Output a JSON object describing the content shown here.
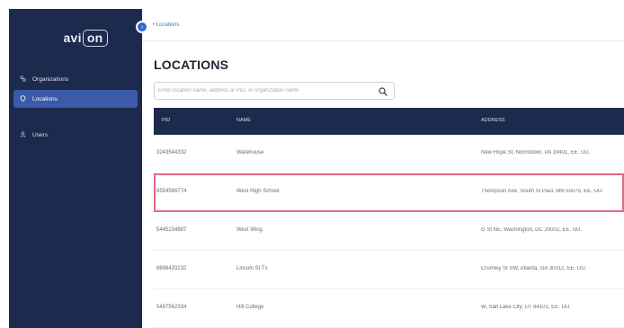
{
  "logo": {
    "prefix": "avi",
    "boxed": "on"
  },
  "sidebar": {
    "items": [
      {
        "label": "Organizations",
        "icon": "organizations-icon",
        "active": false
      },
      {
        "label": "Locations",
        "icon": "location-pin-icon",
        "active": true
      },
      {
        "label": "Users",
        "icon": "users-icon",
        "active": false
      }
    ],
    "toggle_icon": "chevron-left-icon"
  },
  "breadcrumb": {
    "text": "• Locations"
  },
  "page": {
    "title": "LOCATIONS"
  },
  "search": {
    "placeholder": "Enter location name, address or PID, or organization name",
    "value": "",
    "icon": "search-icon"
  },
  "table": {
    "headers": {
      "pid": "PID",
      "name": "NAME",
      "address": "ADDRESS"
    },
    "rows": [
      {
        "pid": "3243544332",
        "name": "Warehouse",
        "address": "New Hope St, Norristown, PA 19401, EE. UU."
      },
      {
        "pid": "8554586774",
        "name": "West High School",
        "address": "Thompson Ave, South St Paul, MN 55075, EE. UU."
      },
      {
        "pid": "5445234887",
        "name": "West Wing",
        "address": "G St NE, Washington, DC 20002, EE. UU."
      },
      {
        "pid": "8698433232",
        "name": "Lincoln St Tx",
        "address": "Crumley St SW, Atlanta, GA 30312, EE. UU."
      },
      {
        "pid": "5497562334",
        "name": "Hill College",
        "address": "W, Salt Lake City, UT 84101, EE. UU."
      }
    ]
  },
  "colors": {
    "sidebar_bg": "#1b2a4d",
    "active_item": "#3b5aa7",
    "table_header": "#1b2a4d",
    "highlight_border": "#e56a7f",
    "accent": "#2d69d6"
  }
}
